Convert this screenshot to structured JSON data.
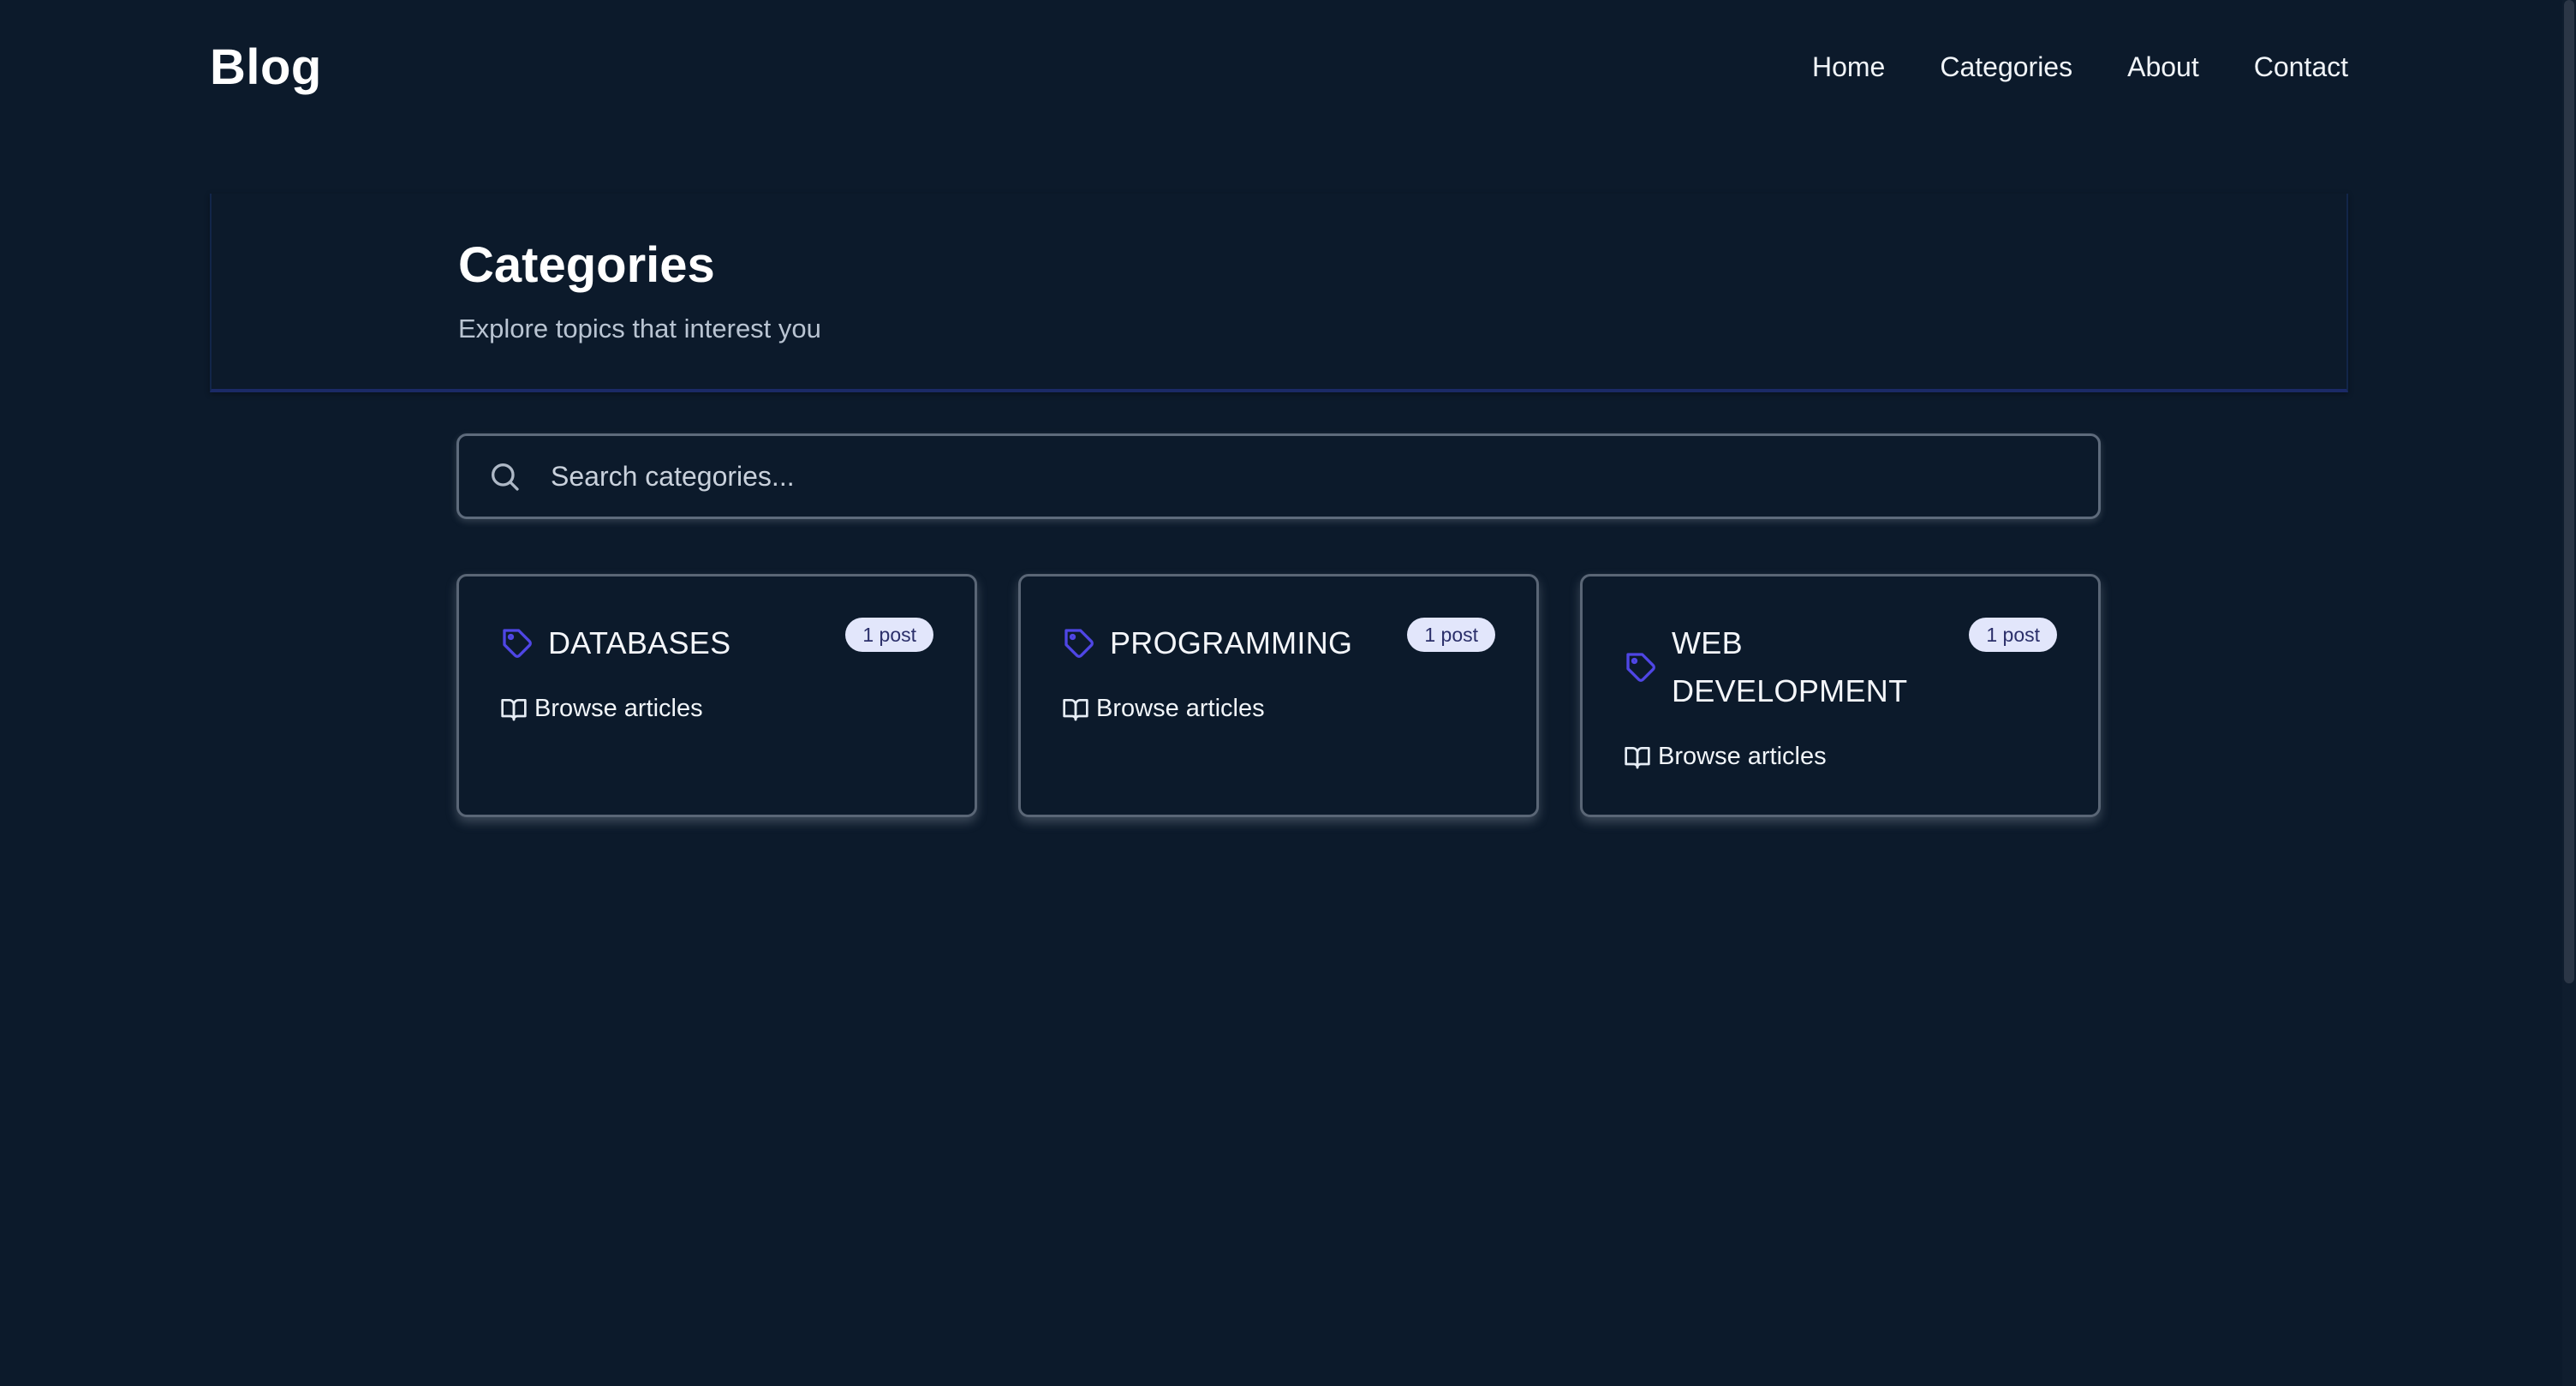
{
  "header": {
    "brand": "Blog",
    "nav": [
      {
        "label": "Home"
      },
      {
        "label": "Categories"
      },
      {
        "label": "About"
      },
      {
        "label": "Contact"
      }
    ]
  },
  "hero": {
    "title": "Categories",
    "subtitle": "Explore topics that interest you"
  },
  "search": {
    "placeholder": "Search categories...",
    "value": ""
  },
  "categories": [
    {
      "name": "DATABASES",
      "count": "1 post",
      "link_label": "Browse articles"
    },
    {
      "name": "PROGRAMMING",
      "count": "1 post",
      "link_label": "Browse articles"
    },
    {
      "name": "WEB DEVELOPMENT",
      "count": "1 post",
      "link_label": "Browse articles"
    }
  ],
  "icons": {
    "search": "search-icon",
    "tag": "tag-icon",
    "book": "book-open-icon"
  },
  "colors": {
    "background": "#0c1a2b",
    "accent": "#4f46e5",
    "badge_bg": "#e2e6fb",
    "badge_text": "#2b2f6a"
  }
}
